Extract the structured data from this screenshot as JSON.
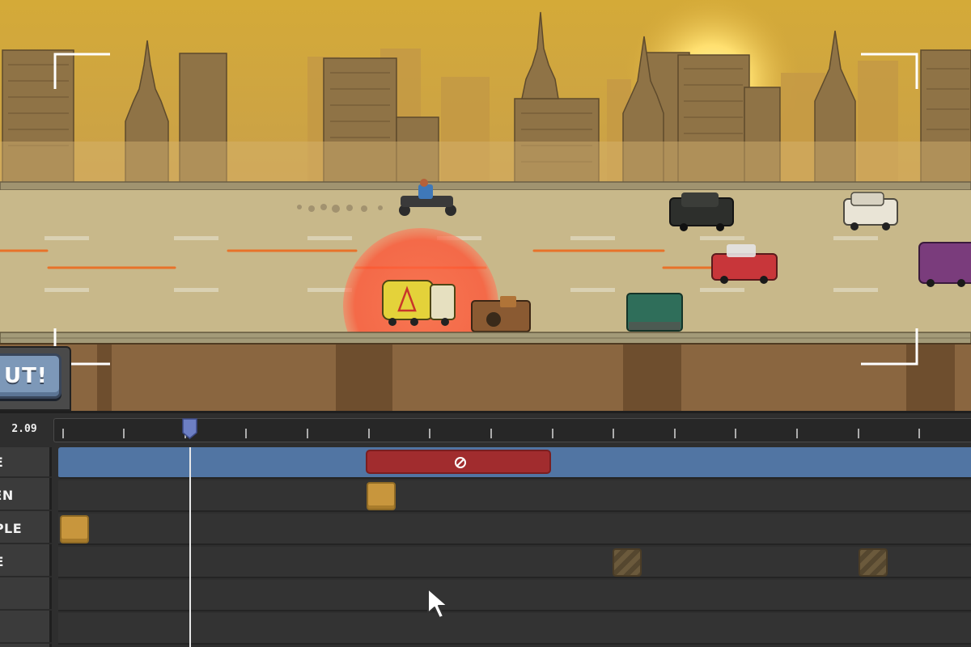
{
  "cut_button": {
    "label": "UT!"
  },
  "timeline": {
    "current_time": "2.09",
    "tracks": [
      {
        "label": "RE"
      },
      {
        "label": "EEN"
      },
      {
        "label": "RPLE"
      },
      {
        "label": "UE"
      },
      {
        "label": ""
      },
      {
        "label": ""
      }
    ],
    "blocked_icon": "no-entry-icon"
  },
  "colors": {
    "sky": "#c9a53a",
    "fire_track": "#5175a3",
    "blocked_segment": "#a12c2e",
    "event_gold": "#c8963d",
    "target_circle": "#ff5a3c"
  }
}
